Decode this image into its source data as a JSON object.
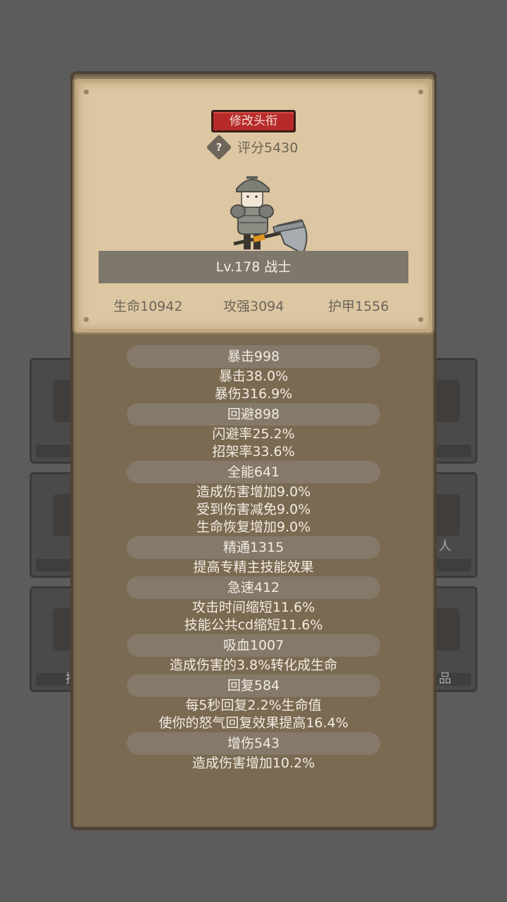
{
  "header": {
    "rename_button": "修改头衔",
    "help_icon_glyph": "?",
    "score_text": "评分5430"
  },
  "hero": {
    "level_class": "Lv.178 战士",
    "base_stats": {
      "hp": "生命10942",
      "attack": "攻强3094",
      "armor": "护甲1556"
    }
  },
  "stats": [
    {
      "title": "暴击998",
      "lines": [
        "暴击38.0%",
        "暴伤316.9%"
      ]
    },
    {
      "title": "回避898",
      "lines": [
        "闪避率25.2%",
        "招架率33.6%"
      ]
    },
    {
      "title": "全能641",
      "lines": [
        "造成伤害增加9.0%",
        "受到伤害减免9.0%",
        "生命恢复增加9.0%"
      ]
    },
    {
      "title": "精通1315",
      "lines": [
        "提高专精主技能效果"
      ]
    },
    {
      "title": "急速412",
      "lines": [
        "攻击时间缩短11.6%",
        "技能公共cd缩短11.6%"
      ]
    },
    {
      "title": "吸血1007",
      "lines": [
        "造成伤害的3.8%转化成生命"
      ]
    },
    {
      "title": "回复584",
      "lines": [
        "每5秒回复2.2%生命值",
        "使你的怒气回复效果提高16.4%"
      ]
    },
    {
      "title": "增伤543",
      "lines": [
        "造成伤害增加10.2%"
      ]
    }
  ],
  "background_tiles": {
    "left_label": "招",
    "right_label_1": "人",
    "right_label_2": "品"
  },
  "colors": {
    "rename_button": "#b72a2a",
    "panel": "#7a6a52",
    "card": "#dcc7a2"
  }
}
